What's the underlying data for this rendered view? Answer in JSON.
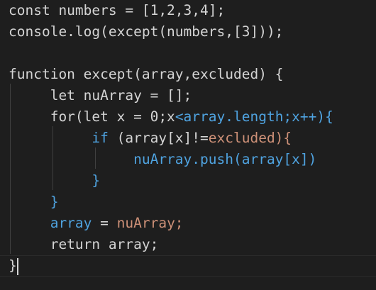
{
  "editor": {
    "theme": {
      "background": "#1e1e1e",
      "foreground": "#d4d4d4",
      "string_like": "#ce9178",
      "property_like": "#4fa3e0",
      "indent_guide": "#404040"
    },
    "lines": [
      [
        {
          "text": "const numbers = [1,2,3,4];",
          "c": "plain"
        }
      ],
      [
        {
          "text": "console.log(except(numbers,[3]));",
          "c": "plain"
        }
      ],
      [
        {
          "text": "",
          "c": "plain"
        }
      ],
      [
        {
          "text": "function except(array,excluded) {",
          "c": "plain"
        }
      ],
      [
        {
          "text": "     let nuArray = [];",
          "c": "plain"
        }
      ],
      [
        {
          "text": "     for(let x = 0;x",
          "c": "plain"
        },
        {
          "text": "<array.length;x++){",
          "c": "blue"
        }
      ],
      [
        {
          "text": "          if ",
          "c": "blue"
        },
        {
          "text": "(array[x]!=",
          "c": "plain"
        },
        {
          "text": "excluded){",
          "c": "red"
        }
      ],
      [
        {
          "text": "               nuArray.push(array[x])",
          "c": "blue"
        }
      ],
      [
        {
          "text": "          }",
          "c": "blue"
        }
      ],
      [
        {
          "text": "     }",
          "c": "blue"
        }
      ],
      [
        {
          "text": "     array ",
          "c": "blue"
        },
        {
          "text": "= ",
          "c": "plain"
        },
        {
          "text": "nuArray;",
          "c": "red"
        }
      ],
      [
        {
          "text": "     return array;",
          "c": "plain"
        }
      ],
      [
        {
          "text": "}",
          "c": "plain"
        }
      ]
    ]
  }
}
